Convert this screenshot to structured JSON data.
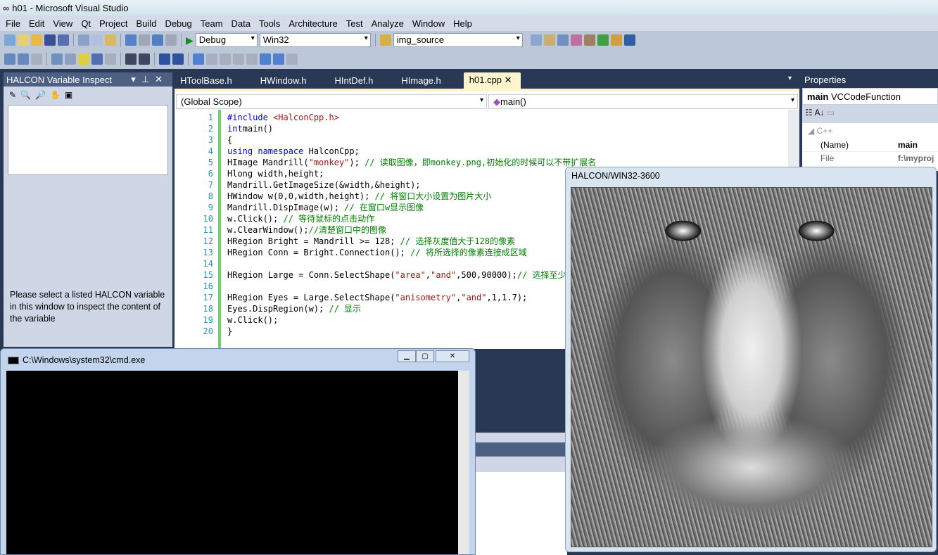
{
  "window": {
    "title": "h01 - Microsoft Visual Studio"
  },
  "menu": [
    "File",
    "Edit",
    "View",
    "Qt",
    "Project",
    "Build",
    "Debug",
    "Team",
    "Data",
    "Tools",
    "Architecture",
    "Test",
    "Analyze",
    "Window",
    "Help"
  ],
  "toolbar": {
    "config": "Debug",
    "platform": "Win32",
    "find": "img_source"
  },
  "left_panel": {
    "title": "HALCON Variable Inspect",
    "message": "Please select a listed HALCON variable in this window to inspect the content of the variable"
  },
  "tabs": [
    {
      "label": "HToolBase.h"
    },
    {
      "label": "HWindow.h"
    },
    {
      "label": "HIntDef.h"
    },
    {
      "label": "HImage.h"
    },
    {
      "label": "h01.cpp",
      "active": true
    }
  ],
  "scope": {
    "left": "(Global Scope)",
    "right": "main()"
  },
  "code": [
    [
      [
        "kw",
        "#include "
      ],
      [
        "str",
        "<HalconCpp.h>"
      ]
    ],
    [
      [
        "kw",
        "int"
      ],
      [
        "",
        "main()"
      ]
    ],
    [
      [
        "",
        "{"
      ]
    ],
    [
      [
        "kw",
        "using namespace "
      ],
      [
        "",
        "HalconCpp;"
      ]
    ],
    [
      [
        "",
        "HImage Mandrill("
      ],
      [
        "str",
        "\"monkey\""
      ],
      [
        "",
        "); "
      ],
      [
        "cm",
        "// 读取图像，即monkey.png,初始化的时候可以不带扩展名"
      ]
    ],
    [
      [
        "",
        "Hlong width,height;"
      ]
    ],
    [
      [
        "",
        "Mandrill.GetImageSize(&width,&height);"
      ]
    ],
    [
      [
        "",
        "HWindow w(0,0,width,height); "
      ],
      [
        "cm",
        "// 将窗口大小设置为图片大小"
      ]
    ],
    [
      [
        "",
        "Mandrill.DispImage(w); "
      ],
      [
        "cm",
        "// 在窗口w显示图像"
      ]
    ],
    [
      [
        "",
        "w.Click(); "
      ],
      [
        "cm",
        "// 等待鼠标的点击动作"
      ]
    ],
    [
      [
        "",
        "w.ClearWindow();"
      ],
      [
        "cm",
        "//清楚窗口中的图像"
      ]
    ],
    [
      [
        "",
        "HRegion Bright = Mandrill >= 128; "
      ],
      [
        "cm",
        "// 选择灰度值大于128的像素"
      ]
    ],
    [
      [
        "",
        "HRegion Conn = Bright.Connection(); "
      ],
      [
        "cm",
        "// 将所选择的像素连接成区域"
      ]
    ],
    [],
    [
      [
        "",
        "HRegion Large = Conn.SelectShape("
      ],
      [
        "str",
        "\"area\""
      ],
      [
        "",
        ","
      ],
      [
        "str",
        "\"and\""
      ],
      [
        "",
        ",500,90000);"
      ],
      [
        "cm",
        "// 选择至少有"
      ]
    ],
    [],
    [
      [
        "",
        "HRegion Eyes = Large.SelectShape("
      ],
      [
        "str",
        "\"anisometry\""
      ],
      [
        "",
        ","
      ],
      [
        "str",
        "\"and\""
      ],
      [
        "",
        ",1,1.7);"
      ]
    ],
    [
      [
        "",
        "Eyes.DispRegion(w); "
      ],
      [
        "cm",
        "// 显示"
      ]
    ],
    [
      [
        "",
        "w.Click();"
      ]
    ],
    [
      [
        "",
        "}"
      ]
    ]
  ],
  "properties": {
    "title": "Properties",
    "object_name": "main",
    "object_type": "VCCodeFunction",
    "category": "C++",
    "rows": [
      {
        "name": "(Name)",
        "value": "main"
      },
      {
        "name": "File",
        "value": "f:\\myproj"
      }
    ]
  },
  "halcon_window": {
    "title": "HALCON/WIN32-3600"
  },
  "cmd_window": {
    "title": "C:\\Windows\\system32\\cmd.exe"
  }
}
